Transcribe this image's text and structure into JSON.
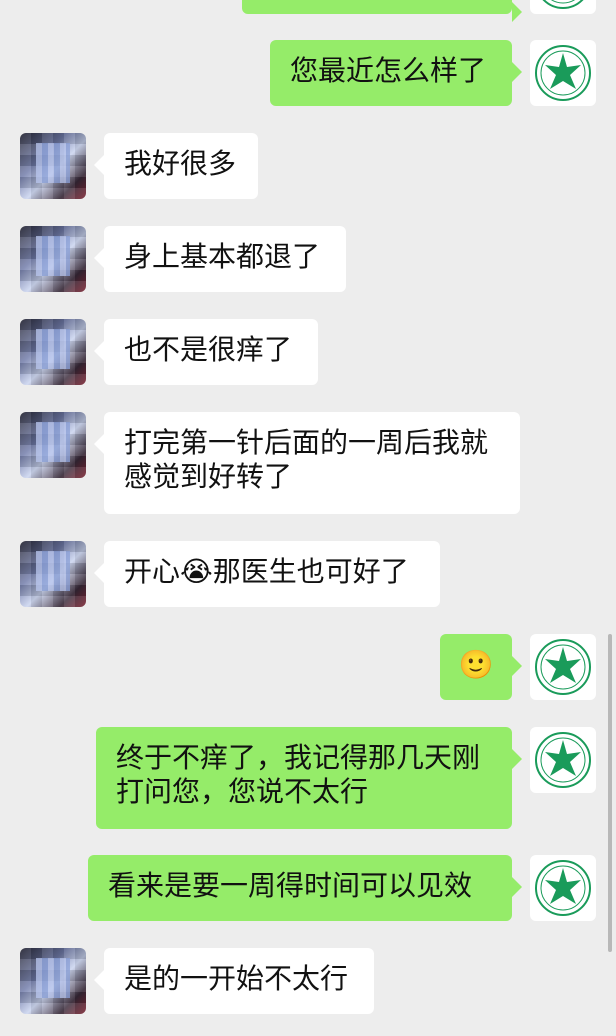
{
  "chat": {
    "messages": [
      {
        "side": "out",
        "lines": [
          ""
        ]
      },
      {
        "side": "out",
        "lines": [
          "您最近怎么样了"
        ]
      },
      {
        "side": "in",
        "lines": [
          "我好很多"
        ]
      },
      {
        "side": "in",
        "lines": [
          "身上基本都退了"
        ]
      },
      {
        "side": "in",
        "lines": [
          "也不是很痒了"
        ]
      },
      {
        "side": "in",
        "lines": [
          "打完第一针后面的一周后我就",
          "感觉到好转了"
        ]
      },
      {
        "side": "in",
        "lines": [
          "开心😭那医生也可好了"
        ]
      },
      {
        "side": "out",
        "lines": [
          "🙂"
        ]
      },
      {
        "side": "out",
        "lines": [
          "终于不痒了，我记得那几天刚",
          "打问您，您说不太行"
        ]
      },
      {
        "side": "out",
        "lines": [
          "看来是要一周得时间可以见效"
        ]
      },
      {
        "side": "in",
        "lines": [
          "是的一开始不太行"
        ]
      }
    ]
  },
  "colors": {
    "background": "#ededed",
    "outgoing_bubble": "#95ec69",
    "incoming_bubble": "#ffffff",
    "emblem_green": "#1a9b5a"
  },
  "icons": {
    "self_avatar": "green-star-emblem-icon",
    "other_avatar": "pixelated-photo-avatar"
  }
}
